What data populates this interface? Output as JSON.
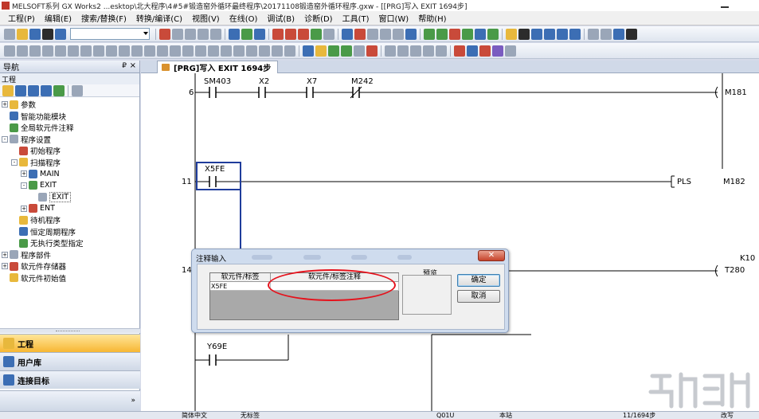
{
  "window": {
    "title": "MELSOFT系列 GX Works2 ...esktop\\北大程序\\4#5#锻造窑外循环最终程序\\20171108锻造窑外循环程序.gxw - [[PRG]写入 EXIT 1694步]"
  },
  "menu": [
    "工程(P)",
    "编辑(E)",
    "搜索/替换(F)",
    "转换/编译(C)",
    "视图(V)",
    "在线(O)",
    "调试(B)",
    "诊断(D)",
    "工具(T)",
    "窗口(W)",
    "帮助(H)"
  ],
  "nav": {
    "header": "导航",
    "pin_glyph": "₽",
    "close_glyph": "×",
    "sub_header": "工程",
    "tree": [
      {
        "label": "参数",
        "indent": 0,
        "exp": "+"
      },
      {
        "label": "智能功能模块",
        "indent": 0,
        "exp": ""
      },
      {
        "label": "全局软元件注释",
        "indent": 0,
        "exp": ""
      },
      {
        "label": "程序设置",
        "indent": 0,
        "exp": "-"
      },
      {
        "label": "初始程序",
        "indent": 1,
        "exp": ""
      },
      {
        "label": "扫描程序",
        "indent": 1,
        "exp": "-"
      },
      {
        "label": "MAIN",
        "indent": 2,
        "exp": "+"
      },
      {
        "label": "EXIT",
        "indent": 2,
        "exp": "-"
      },
      {
        "label": "EXIT",
        "indent": 3,
        "exp": "",
        "selected": true
      },
      {
        "label": "ENT",
        "indent": 2,
        "exp": "+"
      },
      {
        "label": "待机程序",
        "indent": 1,
        "exp": ""
      },
      {
        "label": "恒定周期程序",
        "indent": 1,
        "exp": ""
      },
      {
        "label": "无执行类型指定",
        "indent": 1,
        "exp": ""
      },
      {
        "label": "程序部件",
        "indent": 0,
        "exp": "+"
      },
      {
        "label": "软元件存储器",
        "indent": 0,
        "exp": "+"
      },
      {
        "label": "软元件初始值",
        "indent": 0,
        "exp": ""
      }
    ],
    "buttons": {
      "project": "工程",
      "user_lib": "用户库",
      "connection": "连接目标"
    },
    "more_glyph": "»"
  },
  "editor": {
    "tab_label": "[PRG]写入 EXIT 1694步",
    "rungs": {
      "r1_step": "6",
      "r1_c1": "SM403",
      "r1_c2": "X2",
      "r1_c3": "X7",
      "r1_c4": "M242",
      "r1_coil": "M181",
      "r2_step": "11",
      "r2_c1": "X5FE",
      "r2_instr": "PLS",
      "r2_arg": "M182",
      "r3_step": "14",
      "r3_k": "K10",
      "r3_coil": "T280",
      "r4_c1": "Y69E"
    }
  },
  "dialog": {
    "title": "注释输入",
    "col_device": "软元件/标签",
    "col_comment": "软元件/标签注释",
    "device_value": "X5FE",
    "preview_label": "预览",
    "ok": "确定",
    "cancel": "取消",
    "close_glyph": "✕"
  },
  "status": {
    "lang": "简体中文",
    "label": "无标签",
    "cpu": "Q01U",
    "station": "本站",
    "steps": "11/1694步",
    "mode": "改写"
  },
  "colors": {
    "highlight_ring": "#e5121c",
    "active_nav": "#f7b733"
  }
}
